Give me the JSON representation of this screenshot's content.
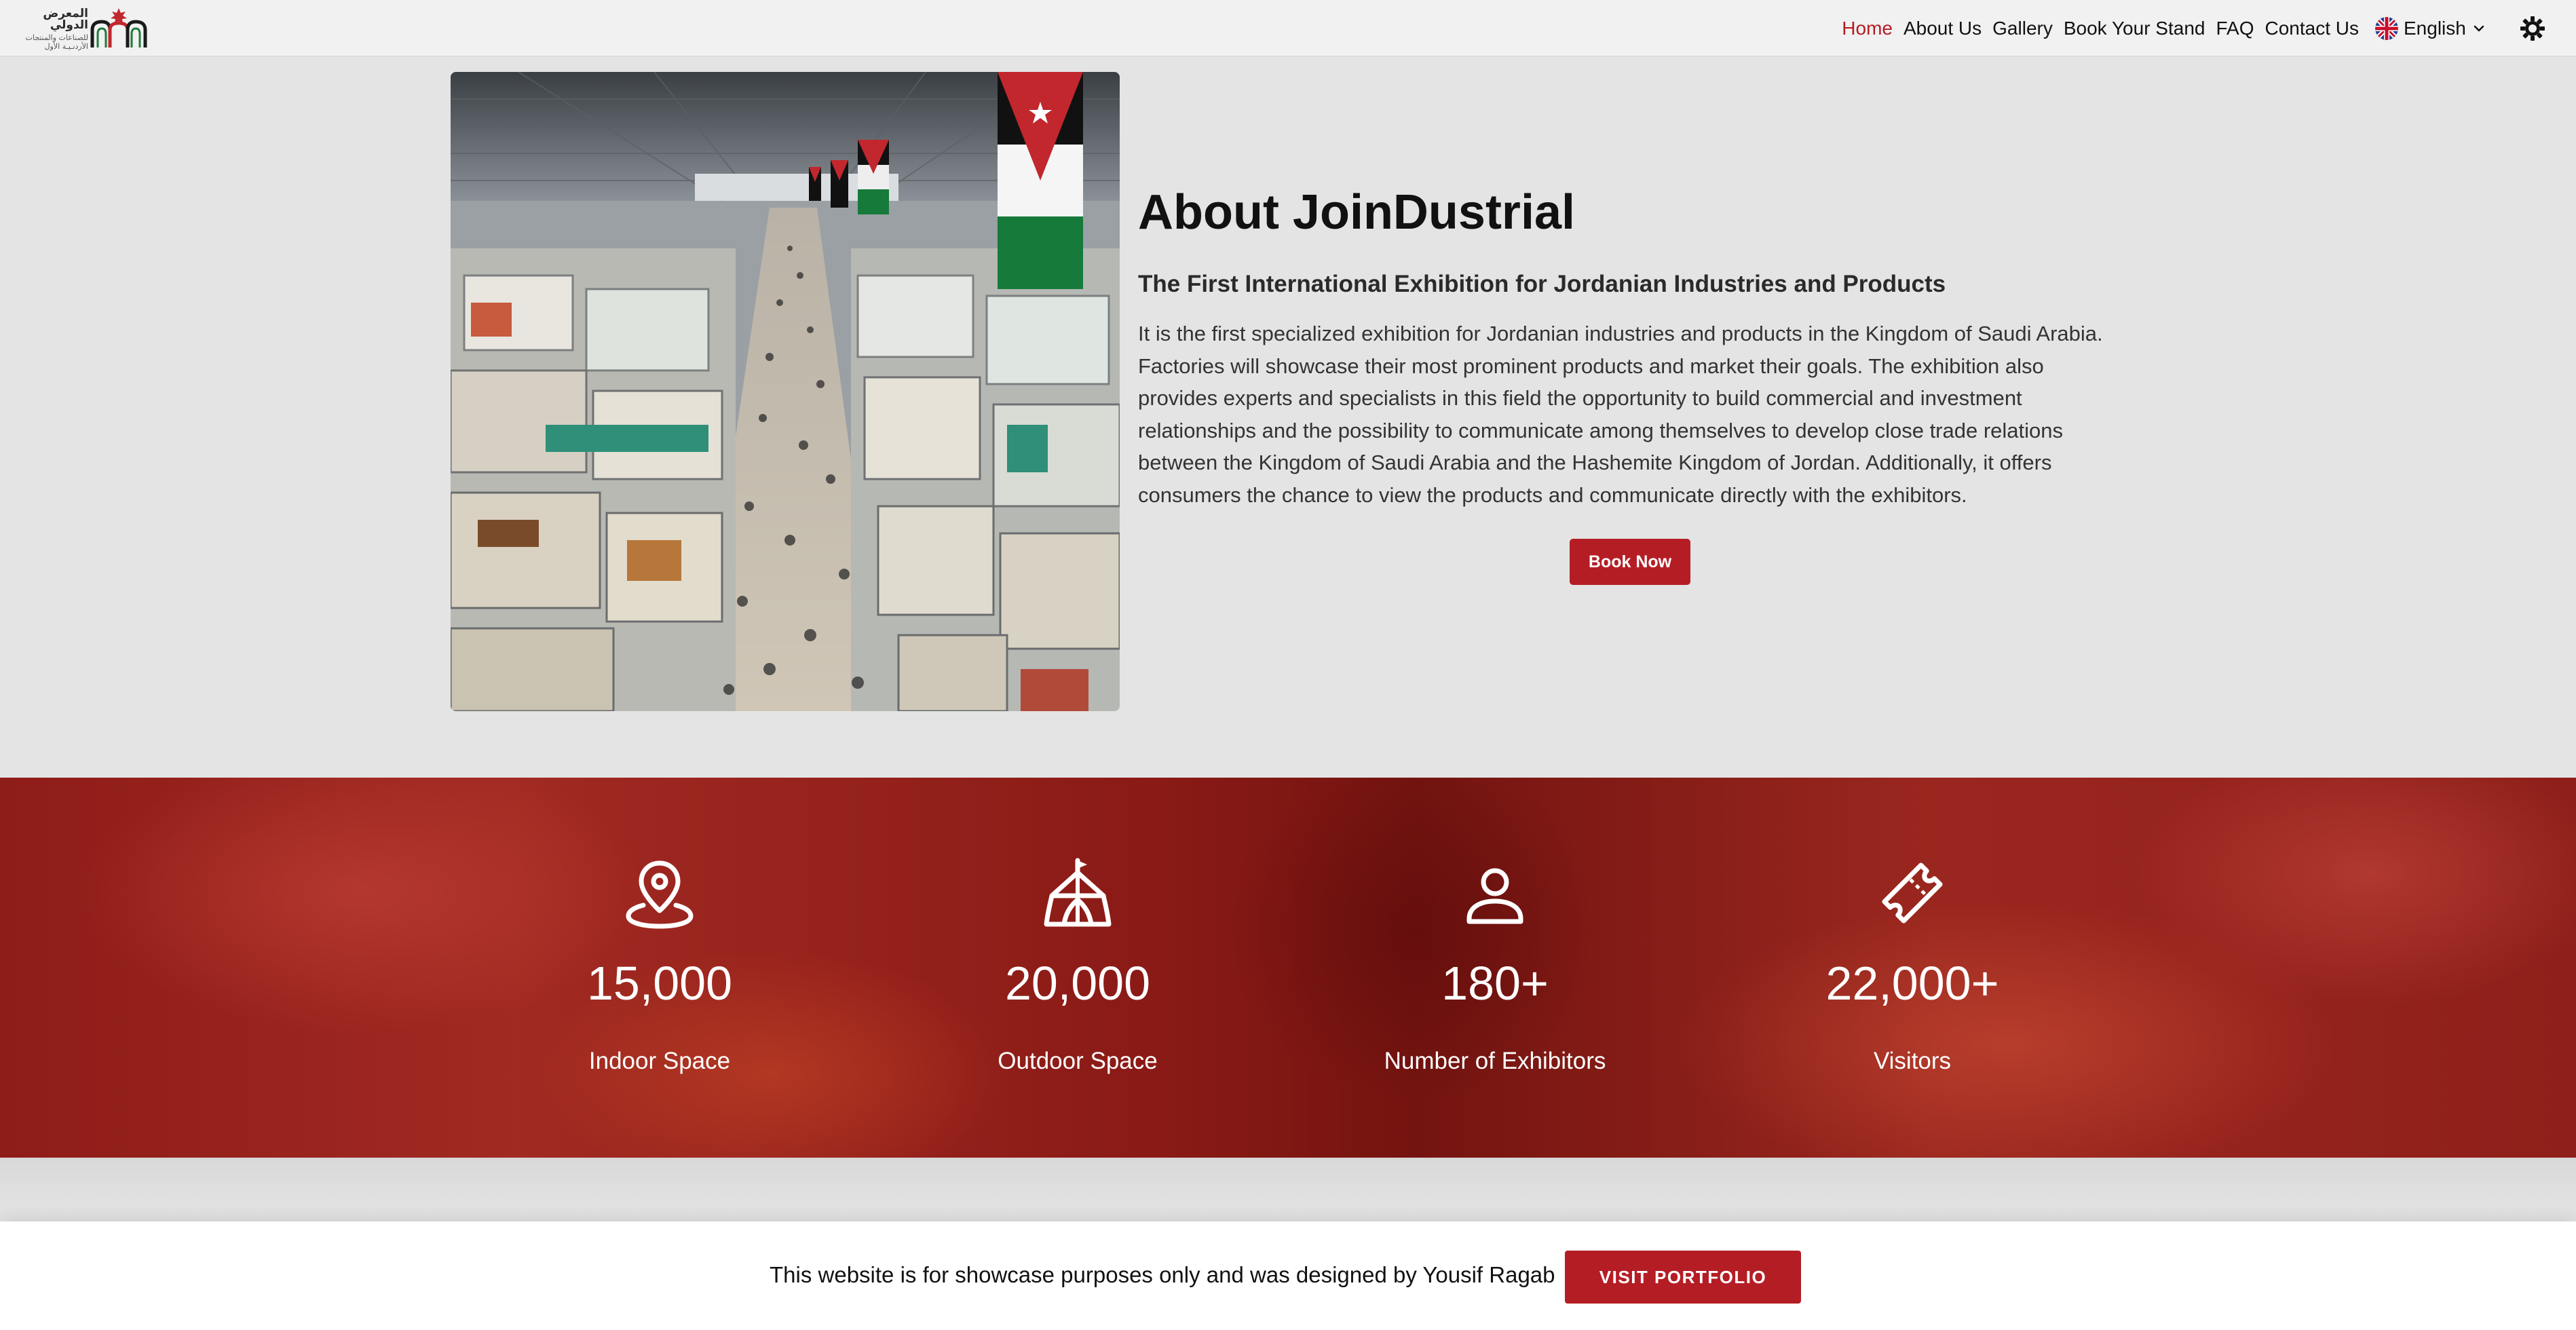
{
  "brand": {
    "logo_line1": "المعرض الدولي",
    "logo_line2": "للصناعات والمنتجات",
    "logo_line3": "الأردنـيـة الأول",
    "logo_icon": "arch-with-star-logo",
    "accent_color": "#b51d25"
  },
  "nav": {
    "items": [
      {
        "label": "Home",
        "active": true
      },
      {
        "label": "About Us",
        "active": false
      },
      {
        "label": "Gallery",
        "active": false
      },
      {
        "label": "Book Your Stand",
        "active": false
      },
      {
        "label": "FAQ",
        "active": false
      },
      {
        "label": "Contact Us",
        "active": false
      }
    ],
    "language": {
      "label": "English",
      "flag_icon": "uk-flag-icon",
      "caret_icon": "chevron-down-icon"
    },
    "theme_toggle_icon": "sun-gear-icon"
  },
  "about": {
    "image_icon": "exhibition-hall-photo",
    "title": "About JoinDustrial",
    "subtitle": "The First International Exhibition for Jordanian Industries and Products",
    "paragraph": "It is the first specialized exhibition for Jordanian industries and products in the Kingdom of Saudi Arabia. Factories will showcase their most prominent products and market their goals. The exhibition also provides experts and specialists in this field the opportunity to build commercial and investment relationships and the possibility to communicate among themselves to develop close trade relations between the Kingdom of Saudi Arabia and the Hashemite Kingdom of Jordan. Additionally, it offers consumers the chance to view the products and communicate directly with the exhibitors.",
    "cta_label": "Book Now"
  },
  "stats": [
    {
      "icon": "map-pin-icon",
      "value": "15,000",
      "label": "Indoor Space"
    },
    {
      "icon": "tent-icon",
      "value": "20,000",
      "label": "Outdoor Space"
    },
    {
      "icon": "user-icon",
      "value": "180+",
      "label": "Number of Exhibitors"
    },
    {
      "icon": "ticket-icon",
      "value": "22,000+",
      "label": "Visitors"
    }
  ],
  "banner": {
    "text": "This website is for showcase purposes only and was designed by Yousif Ragab",
    "button_label": "VISIT PORTFOLIO"
  }
}
